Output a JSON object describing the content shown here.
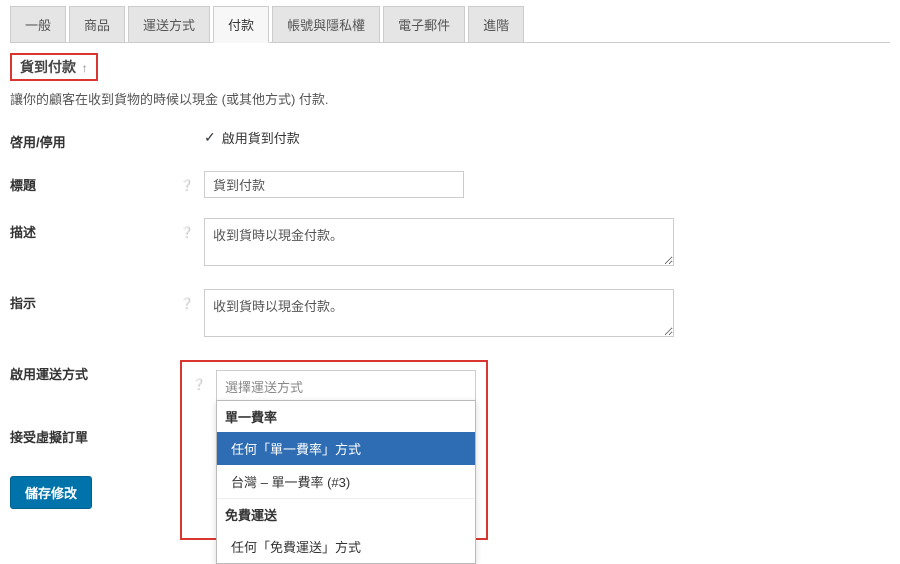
{
  "tabs": {
    "general": "一般",
    "products": "商品",
    "shipping": "運送方式",
    "payment": "付款",
    "accounts": "帳號與隱私權",
    "emails": "電子郵件",
    "advanced": "進階"
  },
  "section": {
    "title": "貨到付款",
    "return_glyph": "↑",
    "description": "讓你的顧客在收到貨物的時候以現金 (或其他方式) 付款."
  },
  "form": {
    "enable": {
      "label": "啓用/停用",
      "checkbox_label": "啟用貨到付款"
    },
    "title_field": {
      "label": "標題",
      "value": "貨到付款"
    },
    "description_field": {
      "label": "描述",
      "value": "收到貨時以現金付款。"
    },
    "instructions_field": {
      "label": "指示",
      "value": "收到貨時以現金付款。"
    },
    "enable_shipping": {
      "label": "啟用運送方式",
      "placeholder": "選擇運送方式"
    },
    "accept_virtual": {
      "label": "接受虛擬訂單"
    }
  },
  "dropdown": {
    "group1": "單一費率",
    "item1": "任何「單一費率」方式",
    "item2": "台灣 – 單一費率 (#3)",
    "group2": "免費運送",
    "item3": "任何「免費運送」方式"
  },
  "save_button": "儲存修改",
  "help_glyph": "❔"
}
